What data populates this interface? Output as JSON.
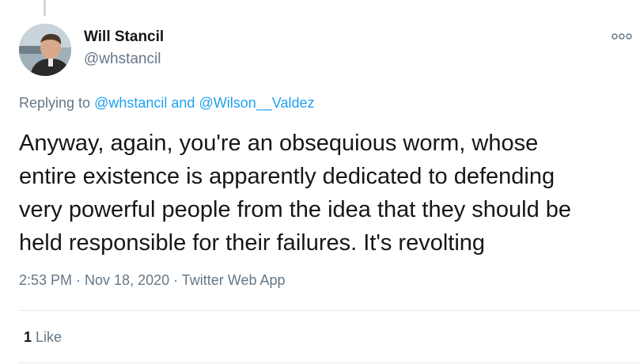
{
  "tweet": {
    "author_name": "Will Stancil",
    "author_handle": "@whstancil",
    "replying_prefix": "Replying to",
    "replying_to_1": "@whstancil",
    "replying_and": "and",
    "replying_to_2": "@Wilson__Valdez",
    "text_lines": [
      "Anyway, again, you're an obsequious worm, whose",
      "entire existence is apparently dedicated to defending",
      "very powerful people from the idea that they should be",
      "held responsible for their failures. It's revolting"
    ],
    "timestamp": "2:53 PM · Nov 18, 2020 · Twitter Web App",
    "like_count": "1",
    "like_label": "Like"
  },
  "icons": {
    "more": "more-options-icon",
    "avatar": "profile-photo"
  },
  "colors": {
    "text": "#14171a",
    "secondary": "#657786",
    "link": "#1da1f2",
    "divider": "#e1e8ed"
  }
}
